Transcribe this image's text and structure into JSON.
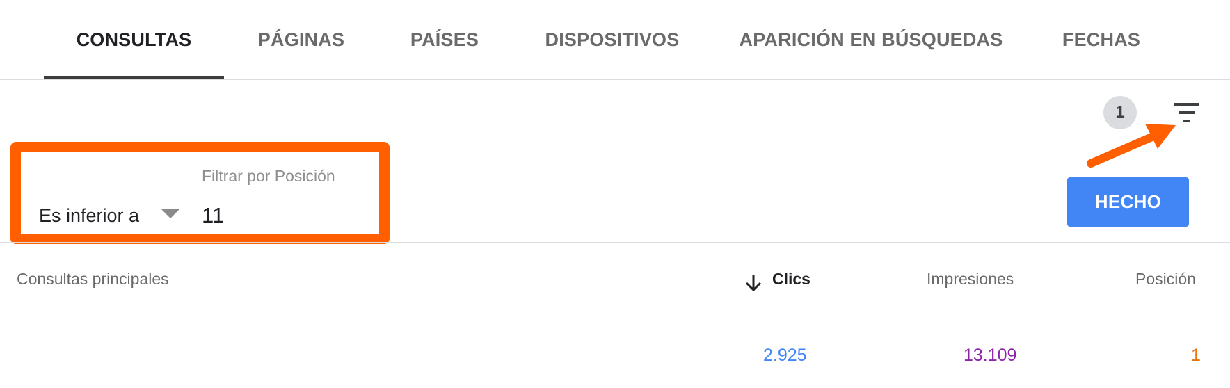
{
  "tabs": [
    {
      "label": "CONSULTAS",
      "active": true
    },
    {
      "label": "PÁGINAS",
      "active": false
    },
    {
      "label": "PAÍSES",
      "active": false
    },
    {
      "label": "DISPOSITIVOS",
      "active": false
    },
    {
      "label": "APARICIÓN EN BÚSQUEDAS",
      "active": false
    },
    {
      "label": "FECHAS",
      "active": false
    }
  ],
  "filter_bar": {
    "active_filter_count": "1",
    "filter_icon": "filter-list-icon"
  },
  "filter": {
    "operator": "Es inferior a",
    "placeholder": "Filtrar por Posición",
    "value": "11",
    "done_label": "HECHO"
  },
  "table": {
    "columns": [
      {
        "label": "Consultas principales",
        "sorted": false
      },
      {
        "label": "Clics",
        "sorted": true,
        "sort_direction": "desc"
      },
      {
        "label": "Impresiones",
        "sorted": false
      },
      {
        "label": "Posición",
        "sorted": false
      }
    ],
    "rows": [
      {
        "query": "",
        "clicks": "2.925",
        "impressions": "13.109",
        "position": "1"
      }
    ]
  },
  "colors": {
    "highlight": "#ff5f00",
    "accent": "#4285f4",
    "clicks": "#4285f4",
    "impressions": "#8e24aa",
    "position": "#e8710a"
  }
}
